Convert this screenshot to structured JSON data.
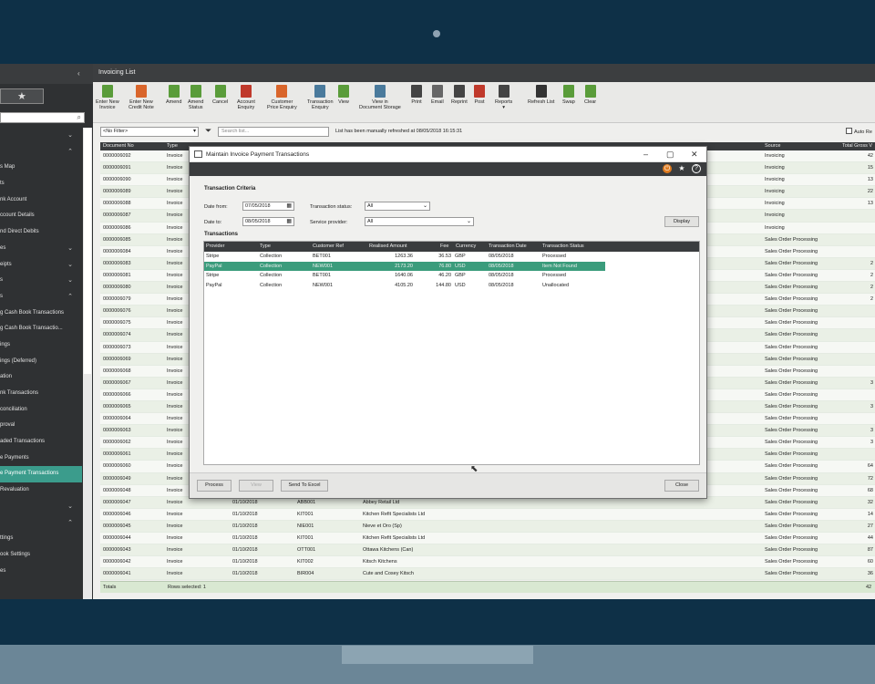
{
  "window": {
    "title": "Invoicing List"
  },
  "sidebar": {
    "items": [
      {
        "label": "",
        "chev": "⌄"
      },
      {
        "label": "",
        "chev": "⌃"
      },
      {
        "label": "s Map",
        "chev": ""
      },
      {
        "label": "ts",
        "chev": ""
      },
      {
        "label": "nk Account",
        "chev": ""
      },
      {
        "label": "ccount Details",
        "chev": ""
      },
      {
        "label": "nd Direct Debits",
        "chev": ""
      },
      {
        "label": "es",
        "chev": "⌄"
      },
      {
        "label": "eipts",
        "chev": "⌄"
      },
      {
        "label": "s",
        "chev": "⌄"
      },
      {
        "label": "s",
        "chev": "⌃"
      },
      {
        "label": "g Cash Book Transactions",
        "chev": ""
      },
      {
        "label": "g Cash Book Transactio...",
        "chev": ""
      },
      {
        "label": "ings",
        "chev": ""
      },
      {
        "label": "ings (Deferred)",
        "chev": ""
      },
      {
        "label": "ation",
        "chev": ""
      },
      {
        "label": "nk Transactions",
        "chev": ""
      },
      {
        "label": "conciliation",
        "chev": ""
      },
      {
        "label": "proval",
        "chev": ""
      },
      {
        "label": "aded Transactions",
        "chev": ""
      },
      {
        "label": "e Payments",
        "chev": ""
      },
      {
        "label": "e Payment Transactions",
        "chev": ""
      },
      {
        "label": "Revaluation",
        "chev": ""
      },
      {
        "label": "",
        "chev": "⌄"
      },
      {
        "label": "",
        "chev": "⌃"
      },
      {
        "label": "ttings",
        "chev": ""
      },
      {
        "label": "ook Settings",
        "chev": ""
      },
      {
        "label": "es",
        "chev": ""
      }
    ]
  },
  "toolbar": {
    "buttons": [
      {
        "label": "Enter New\nInvoice",
        "color": "#5a9c3a"
      },
      {
        "label": "Enter New\nCredit Note",
        "color": "#d9652b"
      },
      {
        "label": "Amend",
        "color": "#5a9c3a"
      },
      {
        "label": "Amend\nStatus",
        "color": "#5a9c3a"
      },
      {
        "label": "Cancel",
        "color": "#5a9c3a"
      },
      {
        "label": "Account\nEnquiry",
        "color": "#c0392b"
      },
      {
        "label": "Customer\nPrice Enquiry",
        "color": "#d9652b"
      },
      {
        "label": "Transaction\nEnquiry",
        "color": "#4a7a9c"
      },
      {
        "label": "View",
        "color": "#5a9c3a"
      },
      {
        "label": "View in\nDocument Storage",
        "color": "#4a7a9c"
      },
      {
        "label": "Print",
        "color": "#444"
      },
      {
        "label": "Email",
        "color": "#666"
      },
      {
        "label": "Reprint",
        "color": "#444"
      },
      {
        "label": "Post",
        "color": "#c0392b"
      },
      {
        "label": "Reports",
        "color": "#444"
      },
      {
        "label": "Refresh List",
        "color": "#333"
      },
      {
        "label": "Swap",
        "color": "#5a9c3a"
      },
      {
        "label": "Clear",
        "color": "#5a9c3a"
      }
    ]
  },
  "filter": {
    "selected": "<No Filter>",
    "search_placeholder": "Search list...",
    "refresh_message": "List has been manually refreshed at 08/05/2018 16:15:31",
    "auto_refresh": "Auto Re"
  },
  "grid": {
    "columns": [
      "Document No",
      "Type",
      "Source",
      "Total Gross V"
    ],
    "rows": [
      {
        "doc": "0000006092",
        "type": "Invoice",
        "date": "",
        "ref": "",
        "name": "",
        "source": "Invoicing",
        "gross": "42"
      },
      {
        "doc": "0000006091",
        "type": "Invoice",
        "date": "",
        "ref": "",
        "name": "",
        "source": "Invoicing",
        "gross": "15"
      },
      {
        "doc": "0000006090",
        "type": "Invoice",
        "date": "",
        "ref": "",
        "name": "",
        "source": "Invoicing",
        "gross": "13"
      },
      {
        "doc": "0000006089",
        "type": "Invoice",
        "date": "",
        "ref": "",
        "name": "",
        "source": "Invoicing",
        "gross": "22"
      },
      {
        "doc": "0000006088",
        "type": "Invoice",
        "date": "",
        "ref": "",
        "name": "",
        "source": "Invoicing",
        "gross": "13"
      },
      {
        "doc": "0000006087",
        "type": "Invoice",
        "date": "",
        "ref": "",
        "name": "",
        "source": "Invoicing",
        "gross": ""
      },
      {
        "doc": "0000006086",
        "type": "Invoice",
        "date": "",
        "ref": "",
        "name": "",
        "source": "Invoicing",
        "gross": ""
      },
      {
        "doc": "0000006085",
        "type": "Invoice",
        "date": "",
        "ref": "",
        "name": "",
        "source": "Sales Order Processing",
        "gross": ""
      },
      {
        "doc": "0000006084",
        "type": "Invoice",
        "date": "",
        "ref": "",
        "name": "",
        "source": "Sales Order Processing",
        "gross": ""
      },
      {
        "doc": "0000006083",
        "type": "Invoice",
        "date": "",
        "ref": "",
        "name": "",
        "source": "Sales Order Processing",
        "gross": "2"
      },
      {
        "doc": "0000006081",
        "type": "Invoice",
        "date": "",
        "ref": "",
        "name": "",
        "source": "Sales Order Processing",
        "gross": "2"
      },
      {
        "doc": "0000006080",
        "type": "Invoice",
        "date": "",
        "ref": "",
        "name": "",
        "source": "Sales Order Processing",
        "gross": "2"
      },
      {
        "doc": "0000006079",
        "type": "Invoice",
        "date": "",
        "ref": "",
        "name": "",
        "source": "Sales Order Processing",
        "gross": "2"
      },
      {
        "doc": "0000006076",
        "type": "Invoice",
        "date": "",
        "ref": "",
        "name": "",
        "source": "Sales Order Processing",
        "gross": ""
      },
      {
        "doc": "0000006075",
        "type": "Invoice",
        "date": "",
        "ref": "",
        "name": "",
        "source": "Sales Order Processing",
        "gross": ""
      },
      {
        "doc": "0000006074",
        "type": "Invoice",
        "date": "",
        "ref": "",
        "name": "",
        "source": "Sales Order Processing",
        "gross": ""
      },
      {
        "doc": "0000006073",
        "type": "Invoice",
        "date": "",
        "ref": "",
        "name": "",
        "source": "Sales Order Processing",
        "gross": ""
      },
      {
        "doc": "0000006069",
        "type": "Invoice",
        "date": "",
        "ref": "",
        "name": "",
        "source": "Sales Order Processing",
        "gross": ""
      },
      {
        "doc": "0000006068",
        "type": "Invoice",
        "date": "",
        "ref": "",
        "name": "",
        "source": "Sales Order Processing",
        "gross": ""
      },
      {
        "doc": "0000006067",
        "type": "Invoice",
        "date": "",
        "ref": "",
        "name": "",
        "source": "Sales Order Processing",
        "gross": "3"
      },
      {
        "doc": "0000006066",
        "type": "Invoice",
        "date": "",
        "ref": "",
        "name": "",
        "source": "Sales Order Processing",
        "gross": ""
      },
      {
        "doc": "0000006065",
        "type": "Invoice",
        "date": "",
        "ref": "",
        "name": "",
        "source": "Sales Order Processing",
        "gross": "3"
      },
      {
        "doc": "0000006064",
        "type": "Invoice",
        "date": "",
        "ref": "",
        "name": "",
        "source": "Sales Order Processing",
        "gross": ""
      },
      {
        "doc": "0000006063",
        "type": "Invoice",
        "date": "",
        "ref": "",
        "name": "",
        "source": "Sales Order Processing",
        "gross": "3"
      },
      {
        "doc": "0000006062",
        "type": "Invoice",
        "date": "",
        "ref": "",
        "name": "",
        "source": "Sales Order Processing",
        "gross": "3"
      },
      {
        "doc": "0000006061",
        "type": "Invoice",
        "date": "",
        "ref": "",
        "name": "",
        "source": "Sales Order Processing",
        "gross": ""
      },
      {
        "doc": "0000006060",
        "type": "Invoice",
        "date": "",
        "ref": "",
        "name": "",
        "source": "Sales Order Processing",
        "gross": "64"
      },
      {
        "doc": "0000006049",
        "type": "Invoice",
        "date": "",
        "ref": "",
        "name": "",
        "source": "Sales Order Processing",
        "gross": "72"
      },
      {
        "doc": "0000006048",
        "type": "Invoice",
        "date": "",
        "ref": "",
        "name": "",
        "source": "Sales Order Processing",
        "gross": "68"
      },
      {
        "doc": "0000006047",
        "type": "Invoice",
        "date": "01/10/2018",
        "ref": "ABB001",
        "name": "Abbey Retail Ltd",
        "source": "Sales Order Processing",
        "gross": "32"
      },
      {
        "doc": "0000006046",
        "type": "Invoice",
        "date": "01/10/2018",
        "ref": "KIT001",
        "name": "Kitchen Refit Specialists Ltd",
        "source": "Sales Order Processing",
        "gross": "14"
      },
      {
        "doc": "0000006045",
        "type": "Invoice",
        "date": "01/10/2018",
        "ref": "NIE001",
        "name": "Nieve et Oro (Sp)",
        "source": "Sales Order Processing",
        "gross": "27"
      },
      {
        "doc": "0000006044",
        "type": "Invoice",
        "date": "01/10/2018",
        "ref": "KIT001",
        "name": "Kitchen Refit Specialists Ltd",
        "source": "Sales Order Processing",
        "gross": "44"
      },
      {
        "doc": "0000006043",
        "type": "Invoice",
        "date": "01/10/2018",
        "ref": "OTT001",
        "name": "Ottawa Kitchens (Can)",
        "source": "Sales Order Processing",
        "gross": "87"
      },
      {
        "doc": "0000006042",
        "type": "Invoice",
        "date": "01/10/2018",
        "ref": "KIT002",
        "name": "Kitsch Kitchens",
        "source": "Sales Order Processing",
        "gross": "60"
      },
      {
        "doc": "0000006041",
        "type": "Invoice",
        "date": "01/10/2018",
        "ref": "BIR004",
        "name": "Cute and Cosey Kitsch",
        "source": "Sales Order Processing",
        "gross": "36"
      }
    ],
    "totals_label": "Totals",
    "rows_selected": "Rows selected: 1",
    "totals_value": "42"
  },
  "dialog": {
    "title": "Maintain Invoice Payment Transactions",
    "criteria_title": "Transaction Criteria",
    "date_from_label": "Date from:",
    "date_from": "07/05/2018",
    "date_to_label": "Date to:",
    "date_to": "08/05/2018",
    "status_label": "Transaction status:",
    "status_value": "All",
    "provider_label": "Service provider:",
    "provider_value": "All",
    "display_label": "Display",
    "transactions_title": "Transactions",
    "columns": [
      "Provider",
      "Type",
      "Customer Ref",
      "Realised Amount",
      "Fee",
      "Currency",
      "Transaction Date",
      "Transaction Status"
    ],
    "rows": [
      {
        "provider": "Stripe",
        "type": "Collection",
        "ref": "BET001",
        "amount": "1263.36",
        "fee": "36.53",
        "currency": "GBP",
        "date": "08/05/2018",
        "status": "Processed",
        "selected": false
      },
      {
        "provider": "PayPal",
        "type": "Collection",
        "ref": "NEW001",
        "amount": "2173.20",
        "fee": "76.80",
        "currency": "USD",
        "date": "08/05/2018",
        "status": "Item Not Found",
        "selected": true
      },
      {
        "provider": "Stripe",
        "type": "Collection",
        "ref": "BET001",
        "amount": "1640.06",
        "fee": "46.20",
        "currency": "GBP",
        "date": "08/05/2018",
        "status": "Processed",
        "selected": false
      },
      {
        "provider": "PayPal",
        "type": "Collection",
        "ref": "NEW001",
        "amount": "4105.20",
        "fee": "144.80",
        "currency": "USD",
        "date": "08/05/2018",
        "status": "Unallocated",
        "selected": false
      }
    ],
    "buttons": {
      "process": "Process",
      "view": "View",
      "send_excel": "Send To Excel",
      "close": "Close"
    }
  }
}
